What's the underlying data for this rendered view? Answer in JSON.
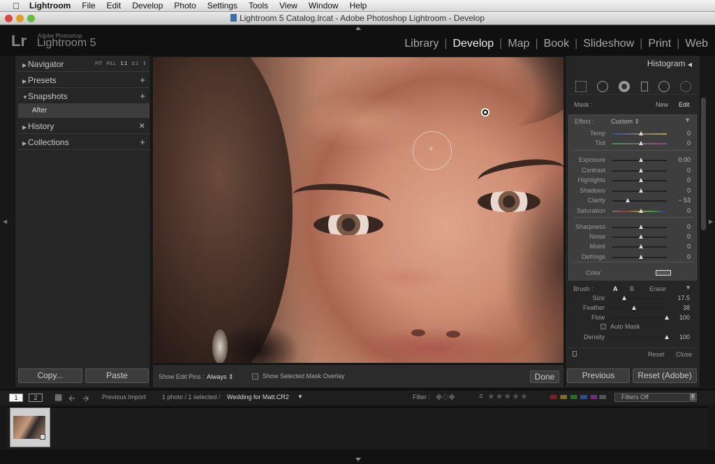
{
  "menubar": {
    "app": "Lightroom",
    "items": [
      "File",
      "Edit",
      "Develop",
      "Photo",
      "Settings",
      "Tools",
      "View",
      "Window",
      "Help"
    ]
  },
  "window": {
    "title": "Lightroom 5 Catalog.lrcat - Adobe Photoshop Lightroom - Develop"
  },
  "identity": {
    "logo": "Lr",
    "line1": "Adobe Photoshop",
    "line2": "Lightroom 5"
  },
  "modules": {
    "items": [
      "Library",
      "Develop",
      "Map",
      "Book",
      "Slideshow",
      "Print",
      "Web"
    ],
    "active": "Develop"
  },
  "left_panel": {
    "navigator": "Navigator",
    "nav_fit": "FIT",
    "nav_fill": "FILL",
    "nav_1": "1:1",
    "nav_3": "3:1",
    "presets": "Presets",
    "snapshots": "Snapshots",
    "snapshot_item": "After",
    "history": "History",
    "collections": "Collections",
    "copy_button": "Copy...",
    "paste_button": "Paste"
  },
  "toolbar": {
    "show_edit_pins": "Show Edit Pins :",
    "pins_value": "Always",
    "show_mask": "Show Selected Mask Overlay",
    "done": "Done"
  },
  "right_panel": {
    "histogram": "Histogram",
    "mask_label": "Mask :",
    "mask_new": "New",
    "mask_edit": "Edit",
    "effect_label": "Effect :",
    "effect_value": "Custom",
    "sliders_wb": [
      {
        "label": "Temp",
        "value": "0",
        "pos": 0.5
      },
      {
        "label": "Tint",
        "value": "0",
        "pos": 0.5
      }
    ],
    "sliders_tone": [
      {
        "label": "Exposure",
        "value": "0.00",
        "pos": 0.5
      },
      {
        "label": "Contrast",
        "value": "0",
        "pos": 0.5
      },
      {
        "label": "Highlights",
        "value": "0",
        "pos": 0.5
      },
      {
        "label": "Shadows",
        "value": "0",
        "pos": 0.5
      },
      {
        "label": "Clarity",
        "value": "− 53",
        "pos": 0.25
      },
      {
        "label": "Saturation",
        "value": "0",
        "pos": 0.5
      }
    ],
    "sliders_detail": [
      {
        "label": "Sharpness",
        "value": "0",
        "pos": 0.5
      },
      {
        "label": "Noise",
        "value": "0",
        "pos": 0.5
      },
      {
        "label": "Moiré",
        "value": "0",
        "pos": 0.5
      },
      {
        "label": "Defringe",
        "value": "0",
        "pos": 0.5
      }
    ],
    "color_label": "Color",
    "brush_label": "Brush :",
    "brush_a": "A",
    "brush_b": "B",
    "brush_erase": "Erase",
    "brush_sliders": [
      {
        "label": "Size",
        "value": "17.5",
        "pos": 0.2
      },
      {
        "label": "Feather",
        "value": "38",
        "pos": 0.38
      },
      {
        "label": "Flow",
        "value": "100",
        "pos": 1.0
      }
    ],
    "auto_mask": "Auto Mask",
    "density": {
      "label": "Density",
      "value": "100",
      "pos": 1.0
    },
    "reset": "Reset",
    "close": "Close",
    "previous_button": "Previous",
    "reset_adobe_button": "Reset (Adobe)"
  },
  "filmstrip": {
    "page1": "1",
    "page2": "2",
    "source": "Previous Import",
    "count": "1 photo / 1 selected /",
    "filename": "Wedding for Matt.CR2",
    "filter_label": "Filter :",
    "filter_value": "Filters Off"
  },
  "colors": {
    "panel_bg": "#262626",
    "accent_text": "#eeeeee"
  }
}
